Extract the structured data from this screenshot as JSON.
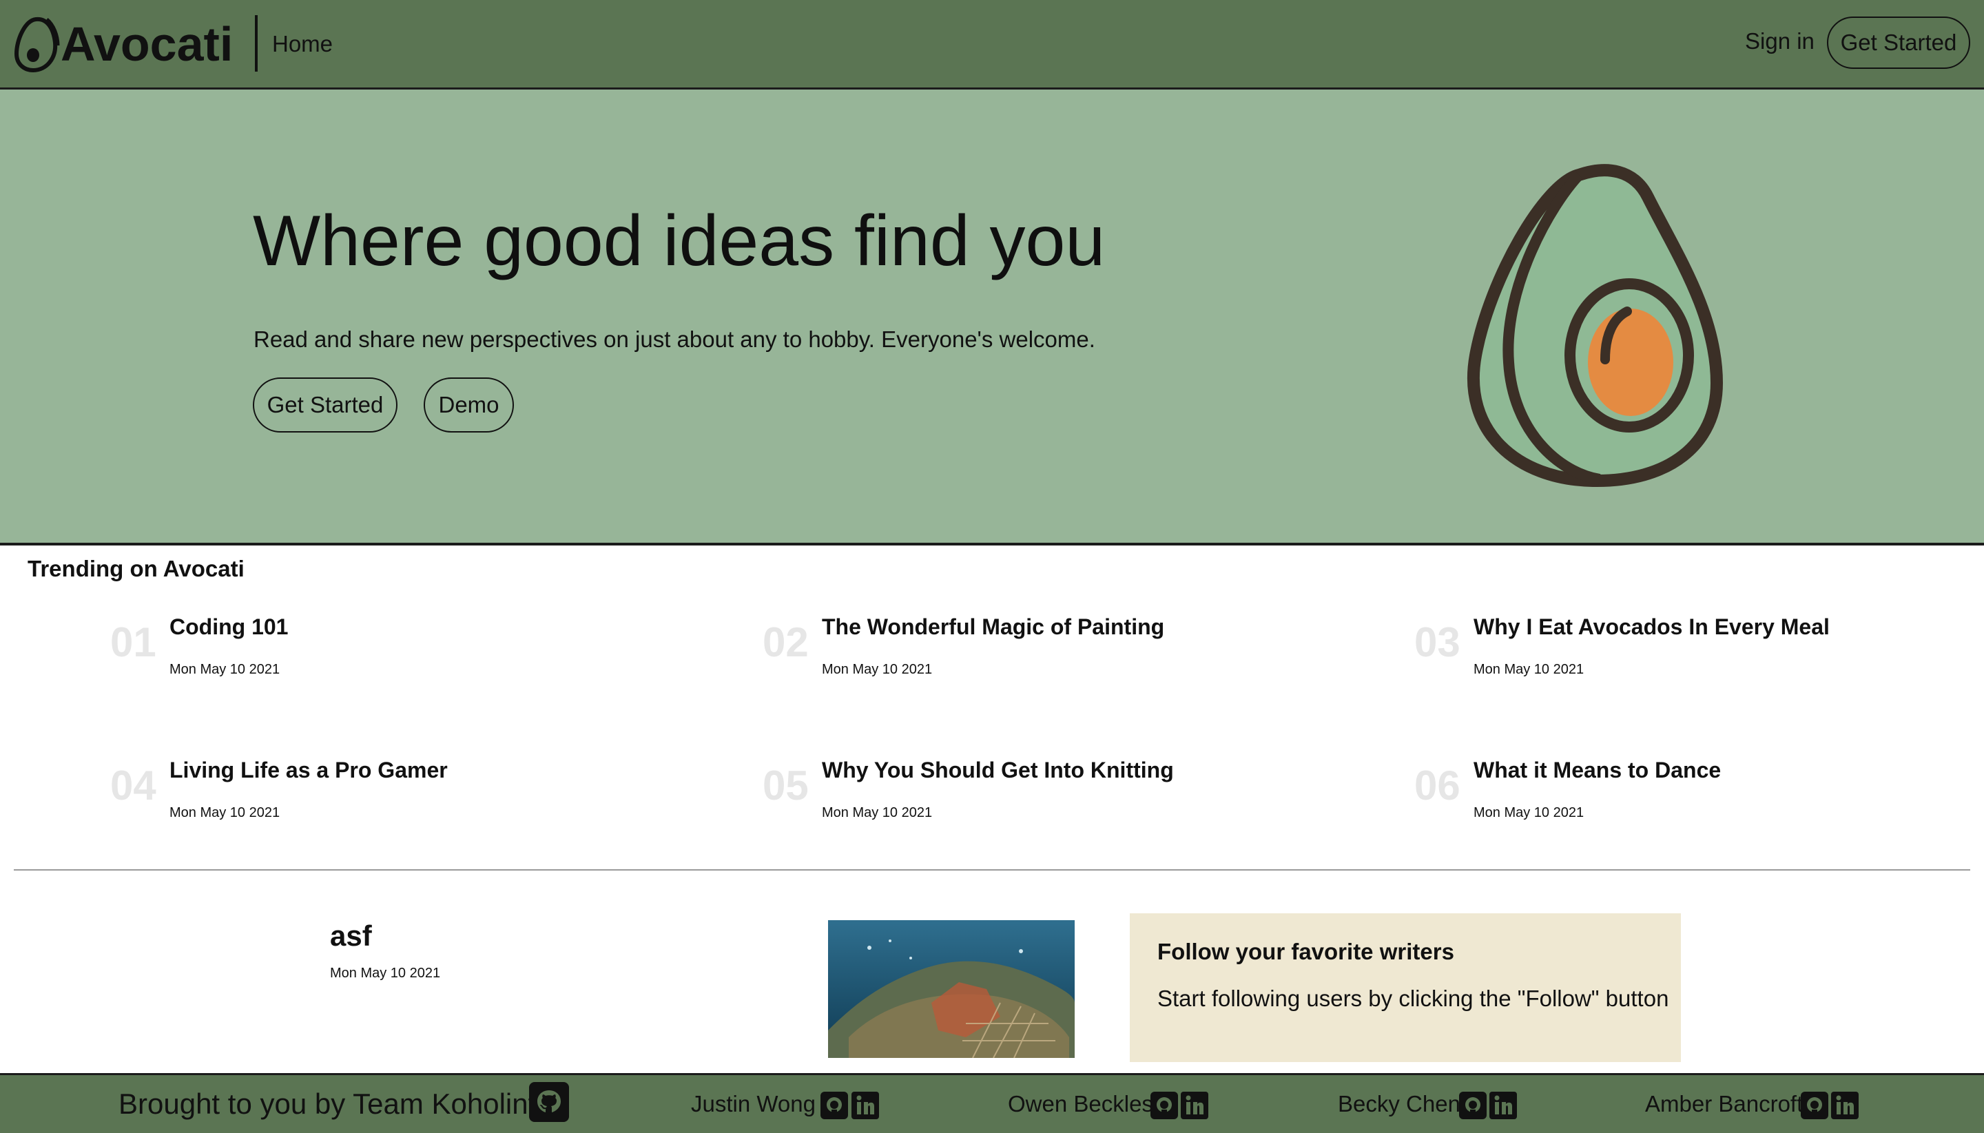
{
  "header": {
    "brand": "Avocati",
    "nav_home": "Home",
    "sign_in": "Sign in",
    "get_started": "Get Started"
  },
  "hero": {
    "title": "Where good ideas find you",
    "subtitle": "Read and share new perspectives on just about any to hobby. Everyone's welcome.",
    "get_started": "Get Started",
    "demo": "Demo"
  },
  "trending": {
    "heading": "Trending on Avocati",
    "items": [
      {
        "num": "01",
        "title": "Coding 101",
        "date": "Mon May 10 2021"
      },
      {
        "num": "02",
        "title": "The Wonderful Magic of Painting",
        "date": "Mon May 10 2021"
      },
      {
        "num": "03",
        "title": "Why I Eat Avocados In Every Meal",
        "date": "Mon May 10 2021"
      },
      {
        "num": "04",
        "title": "Living Life as a Pro Gamer",
        "date": "Mon May 10 2021"
      },
      {
        "num": "05",
        "title": "Why You Should Get Into Knitting",
        "date": "Mon May 10 2021"
      },
      {
        "num": "06",
        "title": "What it Means to Dance",
        "date": "Mon May 10 2021"
      }
    ]
  },
  "feed": {
    "post": {
      "title": "asf",
      "date": "Mon May 10 2021"
    }
  },
  "follow": {
    "title": "Follow your favorite writers",
    "text": "Start following users by clicking the \"Follow\" button"
  },
  "footer": {
    "brand_text": "Brought to you by Team Koholint",
    "members": [
      {
        "name": "Justin Wong",
        "icons": [
          "github-icon",
          "linkedin-icon"
        ]
      },
      {
        "name": "Owen Beckles",
        "icons": [
          "github-icon",
          "linkedin-icon"
        ]
      },
      {
        "name": "Becky Chen",
        "icons": [
          "github-icon",
          "linkedin-icon"
        ]
      },
      {
        "name": "Amber Bancroft",
        "icons": [
          "github-icon",
          "linkedin-icon"
        ]
      }
    ]
  },
  "colors": {
    "header_green": "#5b7553",
    "hero_green": "#97b598",
    "follow_beige": "#efe8d2",
    "avocado_flesh": "#8fb995",
    "avocado_pit": "#e48b42",
    "avocado_outline": "#3b2f26"
  }
}
